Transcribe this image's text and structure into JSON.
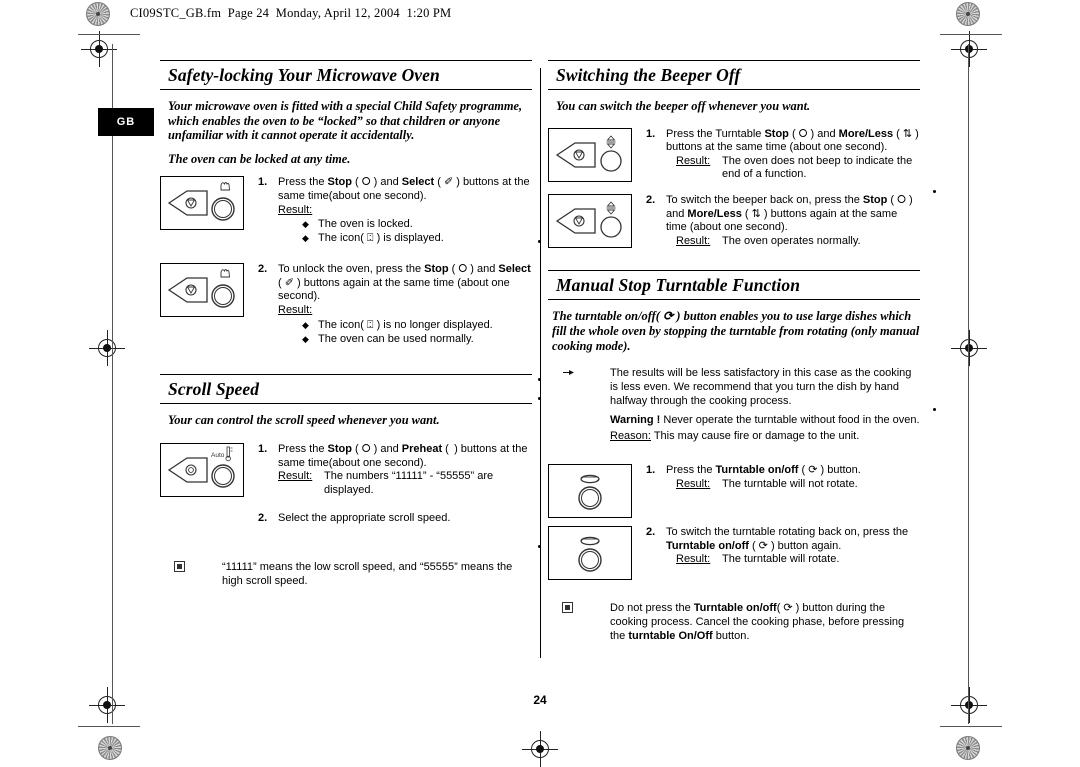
{
  "header": {
    "text": "CI09STC_GB.fm  Page 24  Monday, April 12, 2004  1:20 PM"
  },
  "language_tab": {
    "label": "GB"
  },
  "page": {
    "number": "24"
  },
  "left_column": {
    "sections": [
      {
        "title": "Safety-locking Your Microwave Oven",
        "intro": "Your microwave oven is fitted with a special Child Safety programme, which enables the oven to be “locked” so that children or anyone unfamiliar with it cannot operate it accidentally.",
        "intro2": "The oven can be locked at any time.",
        "steps": [
          {
            "num": "1.",
            "panel": "panel-stop-select",
            "text_parts": {
              "a": "Press the ",
              "bold1": "Stop",
              "b": " ( ⭘ ) and ",
              "bold2": "Select",
              "c": " ( ✐ ) buttons at the same time(about one second)."
            },
            "result_label": "Result:",
            "bullets": [
              "The oven is locked.",
              "The icon( ⍠ ) is displayed."
            ]
          },
          {
            "num": "2.",
            "panel": "panel-stop-select",
            "text_parts": {
              "a": "To unlock the oven, press the ",
              "bold1": "Stop",
              "b": " ( ⭘ ) and ",
              "bold2": "Select",
              "c": " ( ✐ ) buttons again at the same time (about one second)."
            },
            "result_label": "Result:",
            "bullets": [
              "The icon( ⍠ ) is no longer displayed.",
              "The oven can be used normally."
            ]
          }
        ]
      },
      {
        "title": "Scroll Speed",
        "intro": "Your can control the scroll speed whenever you want.",
        "steps": [
          {
            "num": "1.",
            "panel": "panel-stop-preheat",
            "text_parts": {
              "a": "Press the ",
              "bold1": "Stop",
              "b": " ( ⭘ ) and ",
              "bold2": "Preheat",
              "c": " (  ) buttons at the same time(about one second)."
            },
            "result_label": "Result:",
            "result_value": "The numbers “11111” - “55555” are displayed."
          },
          {
            "num": "2.",
            "text": "Select the appropriate scroll speed."
          }
        ],
        "note": {
          "mark": "note-square-icon",
          "text": "“11111” means the low scroll speed, and “55555” means the high scroll speed."
        }
      }
    ]
  },
  "right_column": {
    "sections": [
      {
        "title": "Switching the Beeper Off",
        "intro": "You can switch the beeper off whenever you want.",
        "steps": [
          {
            "num": "1.",
            "panel": "panel-stop-moreless",
            "text_parts": {
              "a": "Press the Turntable ",
              "bold1": "Stop",
              "b": " ( ⭘ ) and ",
              "bold2": "More/Less",
              "c": " ( ⇅ ) buttons at the same time (about one second)."
            },
            "result_label": "Result:",
            "result_value": "The oven does not beep to indicate the end of a function."
          },
          {
            "num": "2.",
            "panel": "panel-stop-moreless",
            "text_parts": {
              "a": "To switch the beeper back on, press the ",
              "bold1": "Stop",
              "b": " ( ⭘ ) and ",
              "bold2": "More/Less",
              "c": " ( ⇅ ) buttons again at the same time (about one second)."
            },
            "result_label": "Result:",
            "result_value": "The oven operates normally."
          }
        ]
      },
      {
        "title": "Manual Stop Turntable Function",
        "intro": "The turntable on/off( ⟳ ) button enables you to use large dishes which fill the whole oven by stopping the turntable from rotating (only manual cooking mode).",
        "hand_note": {
          "mark": "hand-pointer-icon",
          "line1": "The results will be less satisfactory in this case as the cooking is less even. We recommend that you turn the dish by hand halfway through the cooking process.",
          "warning_label": "Warning !",
          "warning_text": " Never operate the turntable without food in the oven.",
          "reason_label": "Reason:",
          "reason_text": " This may cause fire or damage to the unit."
        },
        "steps": [
          {
            "num": "1.",
            "panel": "panel-turntable",
            "text_parts": {
              "a": "Press the ",
              "bold1": "Turntable on/off",
              "b": " ( ⟳ ) button.",
              "bold2": "",
              "c": ""
            },
            "result_label": "Result:",
            "result_value": "The turntable will not rotate."
          },
          {
            "num": "2.",
            "panel": "panel-turntable",
            "text_parts": {
              "a": "To switch the turntable rotating back on, press the ",
              "bold1": "Turntable on/off",
              "b": " ( ⟳ ) button again.",
              "bold2": "",
              "c": ""
            },
            "result_label": "Result:",
            "result_value": "The turntable will rotate."
          }
        ],
        "note": {
          "mark": "note-square-icon",
          "part1": "Do not press the ",
          "bold1": "Turntable on/off",
          "part2": "( ⟳ ) button during the cooking process. Cancel the cooking phase, before pressing the ",
          "bold2": "turntable On/Off",
          "part3": " button."
        }
      }
    ]
  },
  "colors": {
    "ink": "#000000",
    "paper": "#ffffff",
    "registration_grey": "#8a8a8a"
  }
}
